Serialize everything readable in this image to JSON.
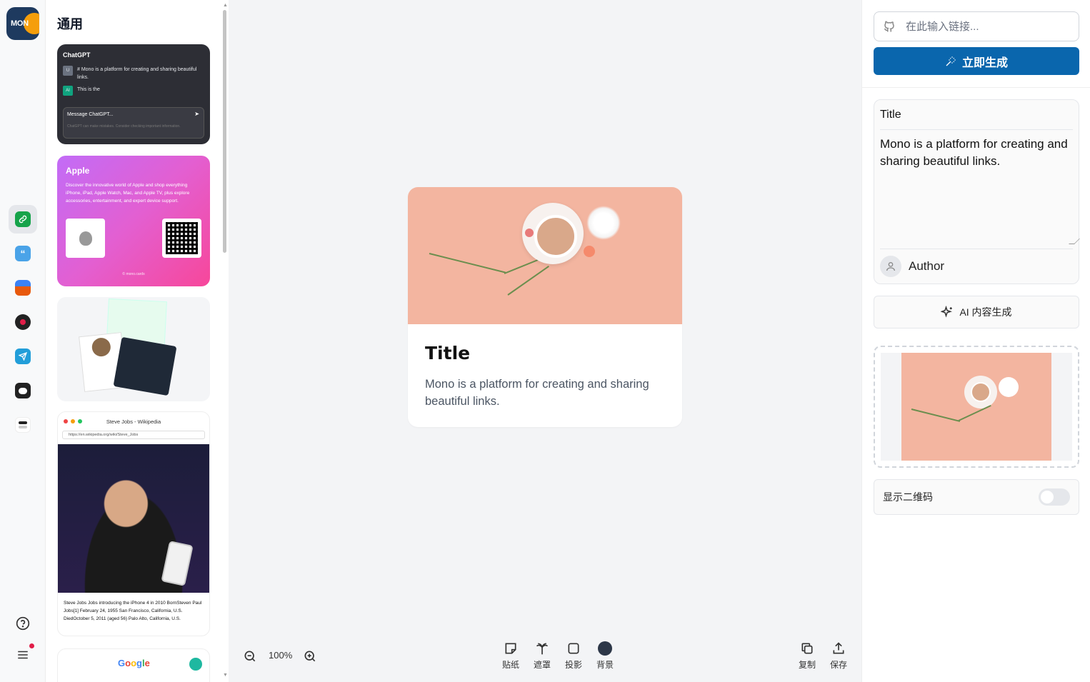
{
  "brand": {
    "logo_text": "MON"
  },
  "templates": {
    "heading": "通用",
    "chatgpt": {
      "title": "ChatGPT",
      "user_avatar": "U",
      "user_msg": "# Mono is a platform for creating and sharing beautiful links.",
      "ai_avatar": "AI",
      "ai_msg": "This is the",
      "input_placeholder": "Message ChatGPT...",
      "disclaimer": "ChatGPT can make mistakes. Consider checking important information."
    },
    "apple": {
      "title": "Apple",
      "description": "Discover the innovative world of Apple and shop everything iPhone, iPad, Apple Watch, Mac, and Apple TV, plus explore accessories, entertainment, and expert device support.",
      "footer": "© mono.cards"
    },
    "wiki": {
      "tab_title": "Steve Jobs - Wikipedia",
      "url": "https://en.wikipedia.org/wiki/Steve_Jobs",
      "caption": "Steve Jobs Jobs introducing the iPhone 4 in 2010 BornSteven Paul Jobs[1] February 24, 1955 San Francisco, California, U.S. DiedOctober 5, 2011 (aged 56) Palo Alto, California, U.S."
    },
    "google": {
      "letters": [
        "G",
        "o",
        "o",
        "g",
        "l",
        "e"
      ]
    }
  },
  "card": {
    "title": "Title",
    "description": "Mono is a platform for creating and sharing beautiful links."
  },
  "toolbar": {
    "zoom": "100%",
    "sticker": "贴纸",
    "mask": "遮罩",
    "shadow": "投影",
    "background": "背景",
    "copy": "复制",
    "save": "保存"
  },
  "panel": {
    "url_placeholder": "在此输入链接...",
    "generate_label": "立即生成",
    "title_value": "Title",
    "description_value": "Mono is a platform for creating and sharing beautiful links.",
    "author": "Author",
    "ai_label": "AI 内容生成",
    "qr_label": "显示二维码",
    "qr_enabled": false
  },
  "colors": {
    "accent": "#0a66ad",
    "card_image_bg": "#f3b5a0",
    "background_swatch": "#2d3748"
  }
}
